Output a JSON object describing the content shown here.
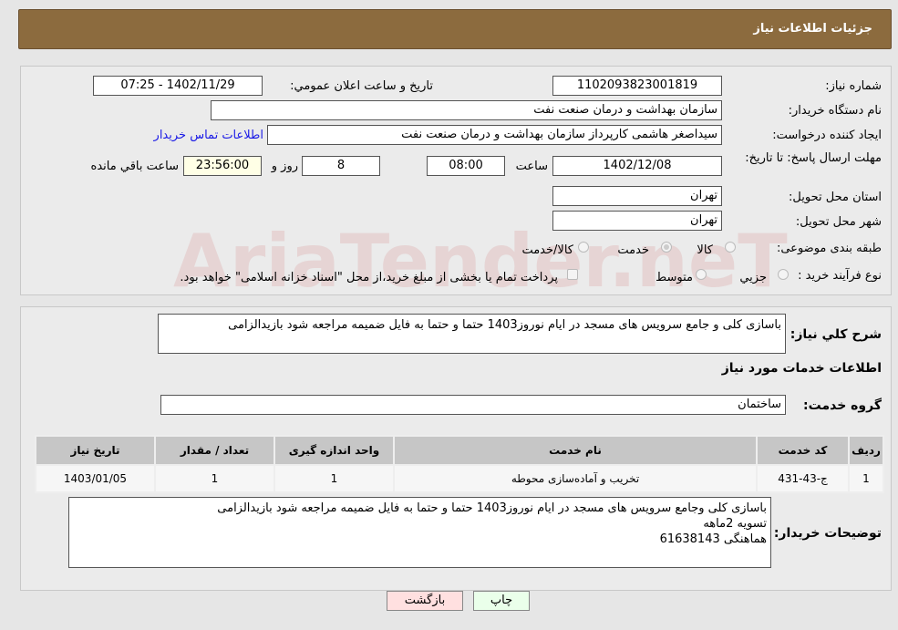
{
  "header": {
    "title": "جزئیات اطلاعات نیاز"
  },
  "form": {
    "need_number_label": "شماره نیاز:",
    "need_number": "1102093823001819",
    "announce_label": "تاریخ و ساعت اعلان عمومي:",
    "announce_value": "1402/11/29 - 07:25",
    "buyer_org_label": "نام دستگاه خريدار:",
    "buyer_org": "سازمان بهداشت و درمان صنعت نفت",
    "creator_label": "ايجاد كننده درخواست:",
    "creator": "سیداصغر هاشمی کارپرداز سازمان بهداشت و درمان صنعت نفت",
    "contact_link": "اطلاعات تماس خريدار",
    "deadline_label": "مهلت ارسال پاسخ: تا تاريخ:",
    "deadline_date": "1402/12/08",
    "time_label": "ساعت",
    "deadline_time": "08:00",
    "days": "8",
    "days_label": "روز و",
    "remaining": "23:56:00",
    "remaining_label": "ساعت باقي مانده",
    "province_label": "استان محل تحويل:",
    "province": "تهران",
    "city_label": "شهر محل تحويل:",
    "city": "تهران",
    "category_label": "طبقه بندی موضوعی:",
    "category_options": [
      "كالا",
      "خدمت",
      "كالا/خدمت"
    ],
    "category_selected": "خدمت",
    "process_label": "نوع فرآيند خريد :",
    "process_options": [
      "جزيي",
      "متوسط"
    ],
    "process_note": "پرداخت تمام یا بخشی از مبلغ خرید،از محل \"اسناد خزانه اسلامی\" خواهد بود."
  },
  "watermark": "AriaTender.neT",
  "details": {
    "desc_label": "شرح كلي نياز:",
    "desc": "باسازی کلی و جامع سرویس های مسجد در ایام نوروز1403 حتما و حتما به فایل ضمیمه مراجعه شود بازیدالزامی",
    "services_title": "اطلاعات خدمات مورد نياز",
    "group_label": "گروه خدمت:",
    "group": "ساختمان",
    "table": {
      "headers": [
        "رديف",
        "كد خدمت",
        "نام خدمت",
        "واحد اندازه گيری",
        "تعداد / مقدار",
        "تاريخ نياز"
      ],
      "rows": [
        [
          "1",
          "ج-43-431",
          "تخریب و آماده‌سازی محوطه",
          "1",
          "1",
          "1403/01/05"
        ]
      ]
    },
    "buyer_notes_label": "توضيحات خريدار:",
    "buyer_notes": [
      "باسازی کلی وجامع سرویس های مسجد در ایام نوروز1403 حتما و حتما به فایل ضمیمه مراجعه شود بازیدالزامی",
      "تسویه 2ماهه",
      "هماهنگی 61638143"
    ]
  },
  "buttons": {
    "print": "چاپ",
    "back": "بازگشت"
  }
}
